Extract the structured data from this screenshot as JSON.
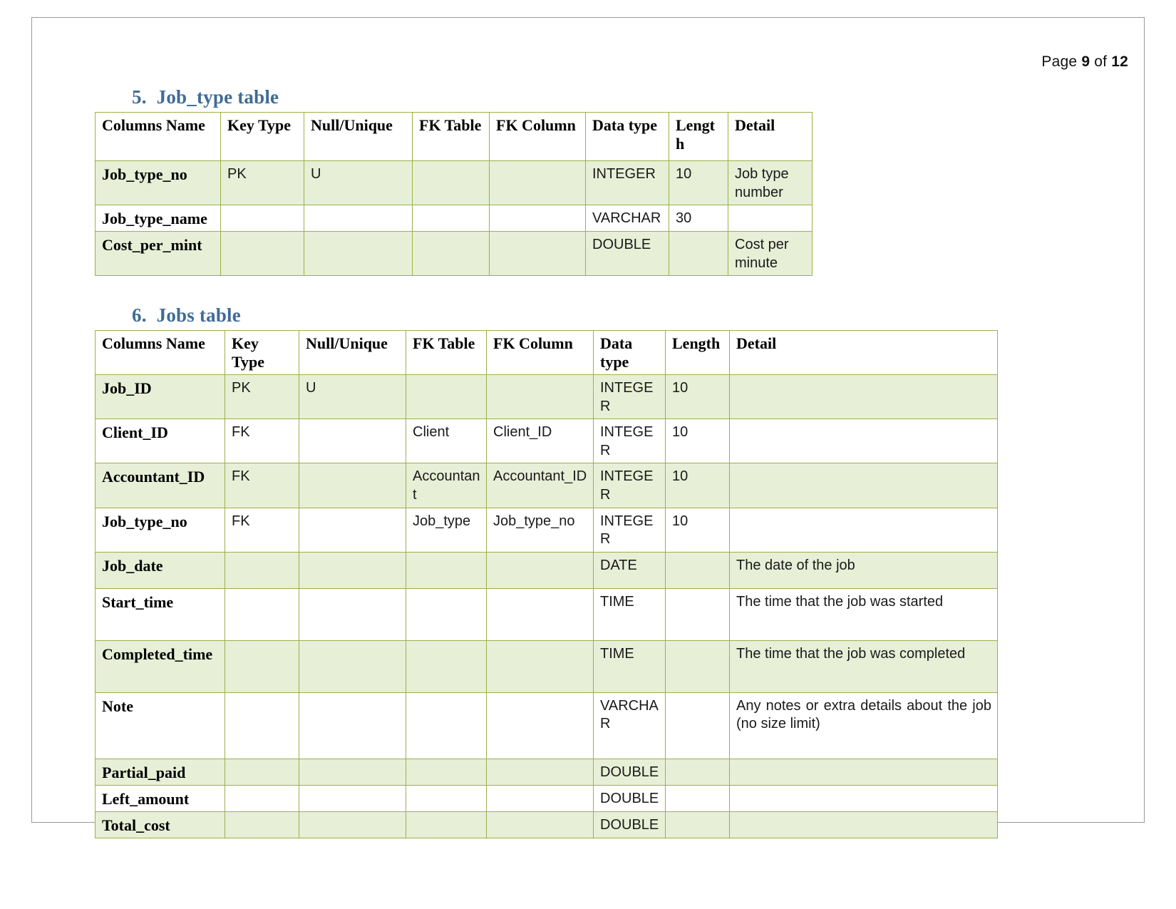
{
  "header": {
    "prefix": "Page",
    "page_number": "9",
    "mid": "of",
    "total_pages": "12"
  },
  "sections": [
    {
      "number": "5.",
      "title": "Job_type table",
      "table": {
        "headers": [
          "Columns Name",
          "Key Type",
          "Null/Unique",
          "FK Table",
          "FK Column",
          "Data type",
          "Length",
          "Detail"
        ],
        "rows": [
          {
            "name": "Job_type_no",
            "key_type": "PK",
            "null_unique": "U",
            "fk_table": "",
            "fk_column": "",
            "data_type": "INTEGER",
            "length": "10",
            "detail": "Job type number"
          },
          {
            "name": "Job_type_name",
            "key_type": "",
            "null_unique": "",
            "fk_table": "",
            "fk_column": "",
            "data_type": "VARCHAR",
            "length": "30",
            "detail": ""
          },
          {
            "name": "Cost_per_mint",
            "key_type": "",
            "null_unique": "",
            "fk_table": "",
            "fk_column": "",
            "data_type": "DOUBLE",
            "length": "",
            "detail": "Cost per minute"
          }
        ]
      }
    },
    {
      "number": "6.",
      "title": "Jobs table",
      "table": {
        "headers": [
          "Columns Name",
          "Key Type",
          "Null/Unique",
          "FK Table",
          "FK Column",
          "Data type",
          "Length",
          "Detail"
        ],
        "rows": [
          {
            "name": "Job_ID",
            "key_type": "PK",
            "null_unique": "U",
            "fk_table": "",
            "fk_column": "",
            "data_type": "INTEGER",
            "length": "10",
            "detail": ""
          },
          {
            "name": "Client_ID",
            "key_type": "FK",
            "null_unique": "",
            "fk_table": "Client",
            "fk_column": "Client_ID",
            "data_type": "INTEGER",
            "length": "10",
            "detail": ""
          },
          {
            "name": "Accountant_ID",
            "key_type": "FK",
            "null_unique": "",
            "fk_table": "Accountant",
            "fk_column": "Accountant_ID",
            "data_type": "INTEGER",
            "length": "10",
            "detail": ""
          },
          {
            "name": "Job_type_no",
            "key_type": "FK",
            "null_unique": "",
            "fk_table": "Job_type",
            "fk_column": "Job_type_no",
            "data_type": "INTEGER",
            "length": "10",
            "detail": ""
          },
          {
            "name": "Job_date",
            "key_type": "",
            "null_unique": "",
            "fk_table": "",
            "fk_column": "",
            "data_type": "DATE",
            "length": "",
            "detail": "The date of the job"
          },
          {
            "name": "Start_time",
            "key_type": "",
            "null_unique": "",
            "fk_table": "",
            "fk_column": "",
            "data_type": "TIME",
            "length": "",
            "detail": "The time that the job was started"
          },
          {
            "name": "Completed_time",
            "key_type": "",
            "null_unique": "",
            "fk_table": "",
            "fk_column": "",
            "data_type": "TIME",
            "length": "",
            "detail": "The time that the job was completed"
          },
          {
            "name": "Note",
            "key_type": "",
            "null_unique": "",
            "fk_table": "",
            "fk_column": "",
            "data_type": "VARCHAR",
            "length": "",
            "detail": "Any notes or extra details about the job (no size limit)"
          },
          {
            "name": "Partial_paid",
            "key_type": "",
            "null_unique": "",
            "fk_table": "",
            "fk_column": "",
            "data_type": "DOUBLE",
            "length": "",
            "detail": ""
          },
          {
            "name": "Left_amount",
            "key_type": "",
            "null_unique": "",
            "fk_table": "",
            "fk_column": "",
            "data_type": "DOUBLE",
            "length": "",
            "detail": ""
          },
          {
            "name": "Total_cost",
            "key_type": "",
            "null_unique": "",
            "fk_table": "",
            "fk_column": "",
            "data_type": "DOUBLE",
            "length": "",
            "detail": ""
          }
        ]
      }
    }
  ],
  "colors": {
    "heading": "#3f6c96",
    "table_border": "#9cb04a",
    "row_shade": "#e7efd6",
    "page_border": "#9a9a9a"
  }
}
